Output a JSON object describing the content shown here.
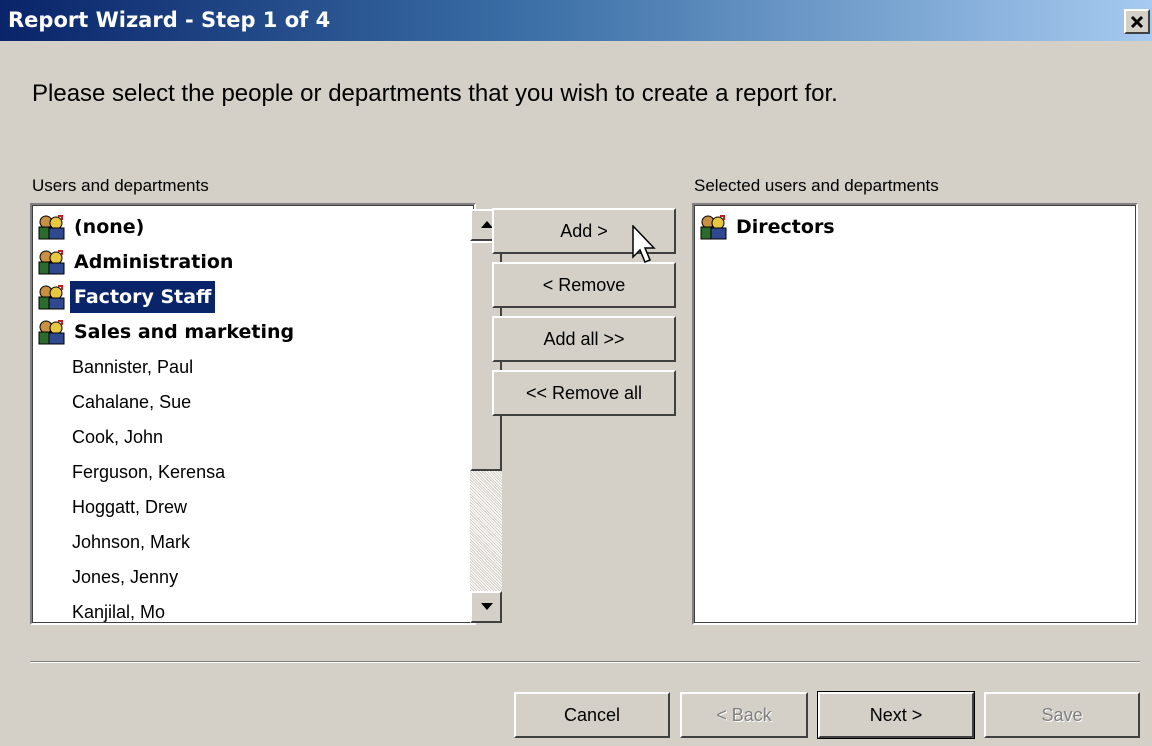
{
  "window": {
    "title": "Report Wizard - Step 1 of 4",
    "close_icon": "close-x-icon"
  },
  "instruction": "Please select the people or departments that you wish to create a report for.",
  "available": {
    "label": "Users and departments",
    "items": [
      {
        "label": "(none)",
        "type": "department",
        "icon": "group-icon"
      },
      {
        "label": "Administration",
        "type": "department",
        "icon": "group-icon"
      },
      {
        "label": "Factory Staff",
        "type": "department",
        "icon": "group-icon",
        "selected": true
      },
      {
        "label": "Sales and marketing",
        "type": "department",
        "icon": "group-icon"
      },
      {
        "label": "Bannister, Paul",
        "type": "user"
      },
      {
        "label": "Cahalane, Sue",
        "type": "user"
      },
      {
        "label": "Cook, John",
        "type": "user"
      },
      {
        "label": "Ferguson, Kerensa",
        "type": "user"
      },
      {
        "label": "Hoggatt, Drew",
        "type": "user"
      },
      {
        "label": "Johnson, Mark",
        "type": "user"
      },
      {
        "label": "Jones, Jenny",
        "type": "user"
      },
      {
        "label": "Kanjilal, Mo",
        "type": "user"
      }
    ]
  },
  "selected": {
    "label": "Selected users and departments",
    "items": [
      {
        "label": "Directors",
        "type": "department",
        "icon": "group-icon"
      }
    ]
  },
  "move_buttons": {
    "add": "Add >",
    "remove": "< Remove",
    "add_all": "Add all >>",
    "remove_all": "<< Remove all"
  },
  "footer_buttons": {
    "cancel": "Cancel",
    "back": "< Back",
    "next": "Next >",
    "save": "Save"
  },
  "colors": {
    "selection": "#0a246a",
    "face": "#d4d0c8"
  }
}
